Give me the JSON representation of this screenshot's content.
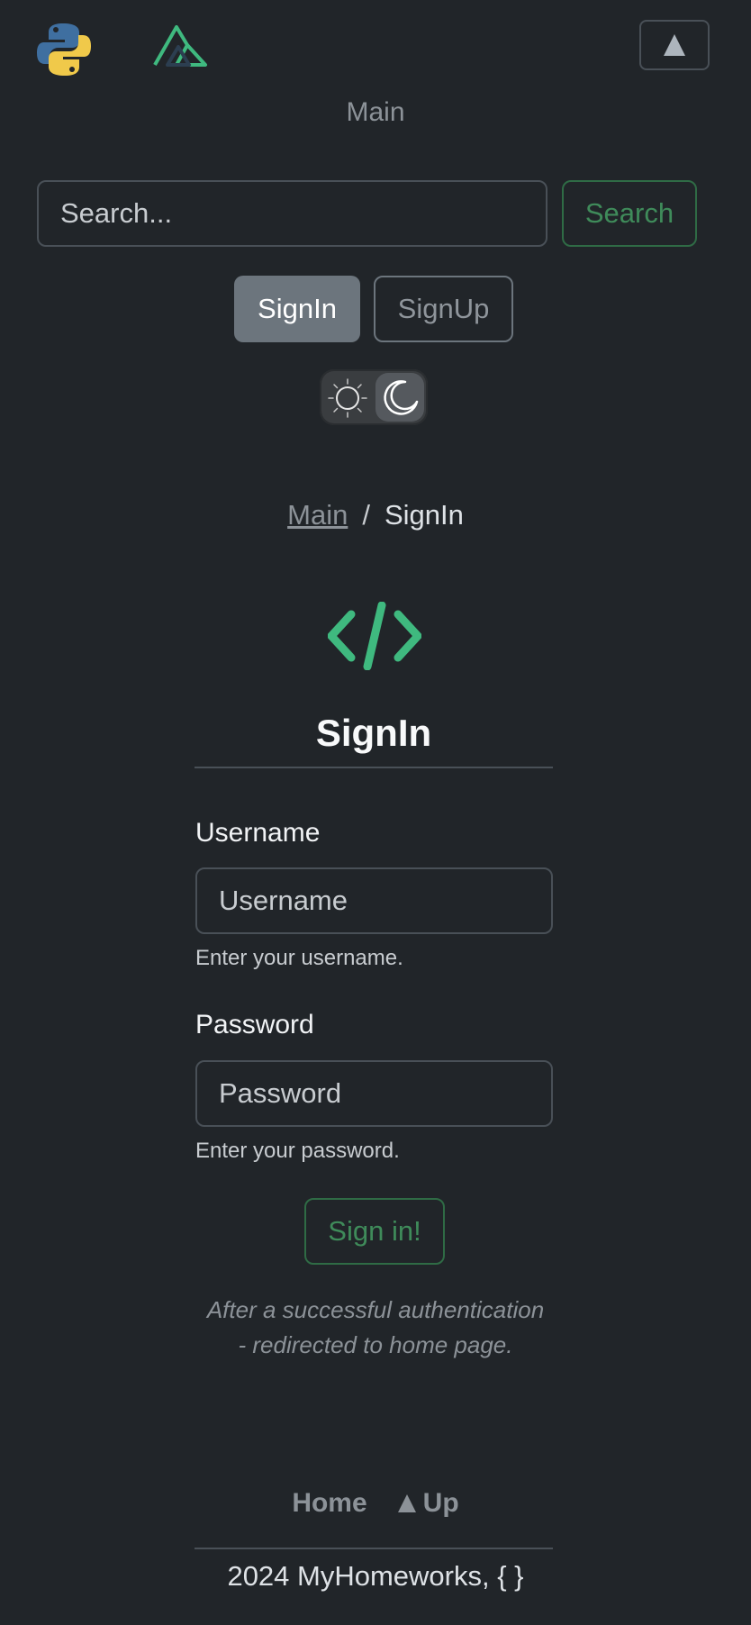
{
  "header": {
    "logos": [
      "python-logo",
      "vue-logo"
    ],
    "menu_toggle_icon": "triangle-up-icon",
    "nav_main": "Main"
  },
  "search": {
    "placeholder": "Search...",
    "button_label": "Search"
  },
  "auth_nav": {
    "signin_label": "SignIn",
    "signup_label": "SignUp"
  },
  "theme_switch": {
    "icons": [
      "sun-icon",
      "moon-icon"
    ],
    "mode": "dark"
  },
  "breadcrumb": {
    "link": "Main",
    "separator": "/",
    "current": "SignIn"
  },
  "form": {
    "icon": "code-icon",
    "title": "SignIn",
    "username": {
      "label": "Username",
      "placeholder": "Username",
      "help": "Enter your username."
    },
    "password": {
      "label": "Password",
      "placeholder": "Password",
      "help": "Enter your password."
    },
    "submit_label": "Sign in!",
    "note_line1": "After a successful authentication",
    "note_line2": "- redirected to home page."
  },
  "footer": {
    "home_label": "Home",
    "up_label": "Up",
    "copyright": "2024 MyHomeworks, { }"
  },
  "colors": {
    "background": "#212529",
    "accent_green": "#3f8b5a",
    "secondary": "#6c757d",
    "code_icon": "#3fb97f"
  }
}
